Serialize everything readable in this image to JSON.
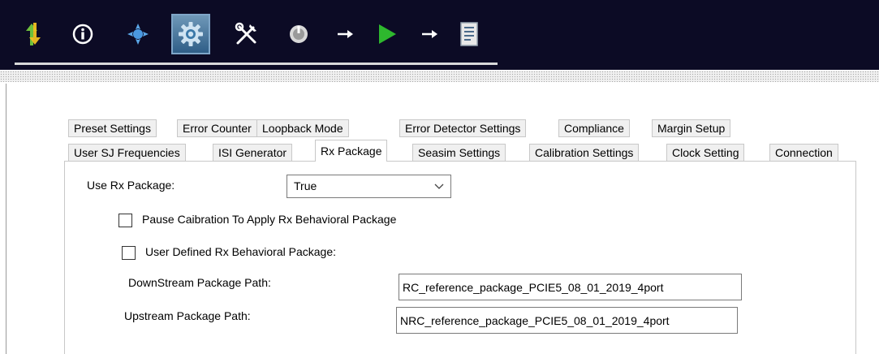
{
  "toolbar": {
    "icons": [
      "updown-arrows-icon",
      "info-icon",
      "crosshair-icon",
      "settings-gear-icon",
      "tools-icon",
      "power-icon",
      "arrow-right-icon",
      "play-icon",
      "arrow-right-icon",
      "report-icon"
    ],
    "active_icon": "settings-gear-icon",
    "colors": {
      "background": "#0c0b25",
      "play": "#2eb82e",
      "updown_green": "#6ec03c",
      "updown_yellow": "#f0c020"
    }
  },
  "tabs_row1": [
    "Preset Settings",
    "Error Counter",
    "Loopback Mode",
    "Error Detector Settings",
    "Compliance",
    "Margin Setup"
  ],
  "tabs_row2": [
    "User SJ Frequencies",
    "ISI Generator",
    "Rx Package",
    "Seasim Settings",
    "Calibration Settings",
    "Clock Setting",
    "Connection"
  ],
  "selected_tab": "Rx Package",
  "form": {
    "use_rx_package_label": "Use Rx Package:",
    "use_rx_package_value": "True",
    "pause_calibration_label": "Pause Caibration To Apply Rx Behavioral Package",
    "pause_calibration_checked": false,
    "user_defined_label": "User Defined Rx Behavioral Package:",
    "user_defined_checked": false,
    "downstream_label": "DownStream Package Path:",
    "downstream_value": "RC_reference_package_PCIE5_08_01_2019_4port",
    "upstream_label": "Upstream Package Path:",
    "upstream_value": "NRC_reference_package_PCIE5_08_01_2019_4port"
  }
}
